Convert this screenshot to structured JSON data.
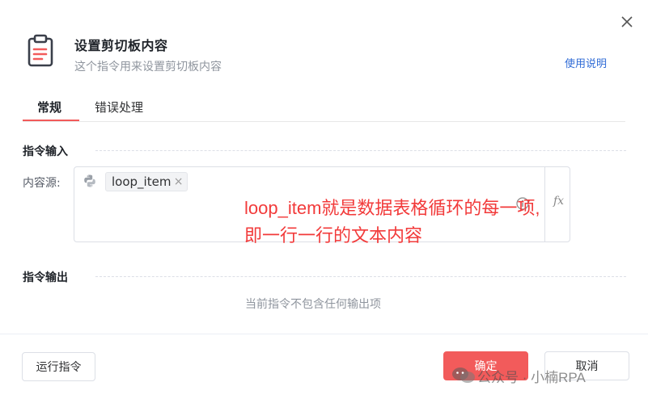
{
  "dialog": {
    "title": "设置剪切板内容",
    "subtitle": "这个指令用来设置剪切板内容",
    "help_link": "使用说明",
    "close_icon": "close-icon",
    "header_icon": "clipboard-icon"
  },
  "tabs": [
    {
      "label": "常规",
      "active": true
    },
    {
      "label": "错误处理",
      "active": false
    }
  ],
  "input_section": {
    "title": "指令输入",
    "field": {
      "label": "内容源:",
      "source_icon": "python-icon",
      "tag_value": "loop_item",
      "tag_close": "×",
      "expression_icon": "fx",
      "info_icon": "info-icon"
    }
  },
  "annotation": {
    "line1": "loop_item就是数据表格循环的每一项,",
    "line2": "即一行一行的文本内容"
  },
  "output_section": {
    "title": "指令输出",
    "empty_text": "当前指令不包含任何输出项"
  },
  "footer": {
    "run_button": "运行指令",
    "ok_button": "确定",
    "cancel_button": "取消"
  },
  "watermark": {
    "text": "公众号 · 小楠RPA"
  },
  "colors": {
    "accent": "#f25b5b",
    "link": "#2f6bd6",
    "annotation": "#f23a3a"
  }
}
